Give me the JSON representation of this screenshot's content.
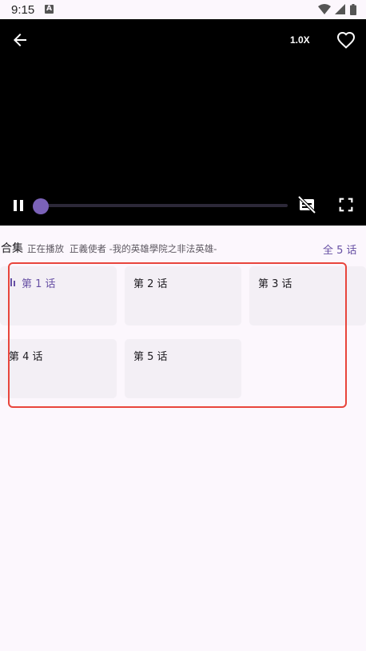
{
  "status_bar": {
    "time": "9:15",
    "notification_icon": "A"
  },
  "player": {
    "speed_label": "1.0X",
    "progress": 0.0,
    "icons": [
      "back-arrow-icon",
      "heart-outline-icon",
      "pause-icon",
      "subtitles-off-icon",
      "fullscreen-icon"
    ]
  },
  "collection": {
    "title": "合集",
    "now_playing_label": "正在播放",
    "now_playing_title": "正義使者 -我的英雄學院之非法英雄-",
    "total_label": "全 5 话"
  },
  "episodes": [
    {
      "label": "第 1 话",
      "active": true
    },
    {
      "label": "第 2 话",
      "active": false
    },
    {
      "label": "第 3 话",
      "active": false
    },
    {
      "label": "第 4 话",
      "active": false
    },
    {
      "label": "第 5 话",
      "active": false
    }
  ],
  "colors": {
    "accent": "#6750a4",
    "background": "#fcf7fd",
    "card": "#f3eff5",
    "highlight": "#e8453c"
  }
}
